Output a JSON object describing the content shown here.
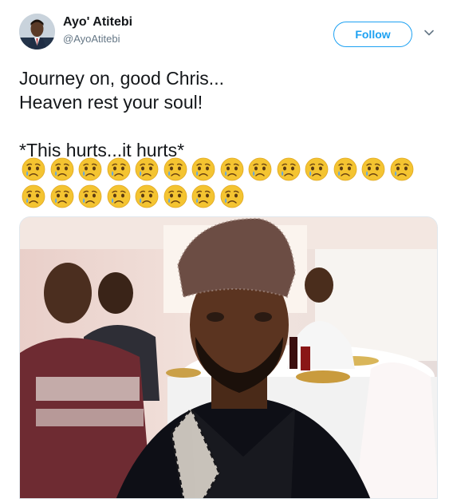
{
  "user": {
    "display_name": "Ayo' Atitebi",
    "handle": "@AyoAtitebi",
    "avatar_icon": "profile-avatar"
  },
  "actions": {
    "follow_label": "Follow",
    "menu_icon": "chevron-down-icon"
  },
  "tweet": {
    "text": "Journey on, good Chris...\nHeaven rest your soul!\n\n*This hurts...it hurts*",
    "emoji_icon": "crying-face-icon",
    "emoji_row1_count": 14,
    "emoji_row2_count": 8
  },
  "colors": {
    "accent": "#1da1f2",
    "secondary_text": "#657786",
    "primary_text": "#14171a"
  }
}
